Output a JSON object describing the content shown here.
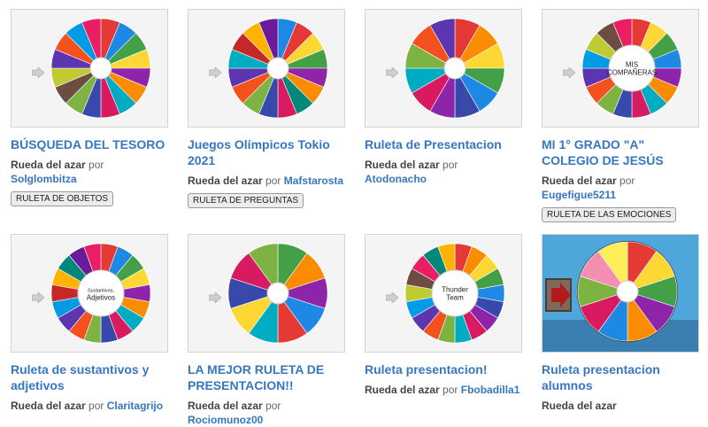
{
  "cards": [
    {
      "title": "BÚSQUEDA DEL TESORO",
      "type": "Rueda del azar",
      "por": "por",
      "author": "Solglombitza",
      "tag": "RULETA DE OBJETOS",
      "colors": [
        "#e53935",
        "#1e88e5",
        "#43a047",
        "#fdd835",
        "#8e24aa",
        "#fb8c00",
        "#00acc1",
        "#d81b60",
        "#3949ab",
        "#7cb342",
        "#6d4c41",
        "#c0ca33",
        "#5e35b1",
        "#f4511e",
        "#039be5",
        "#e91e63"
      ]
    },
    {
      "title": "Juegos Olímpicos Tokio 2021",
      "type": "Rueda del azar",
      "por": "por",
      "author": "Mafstarosta",
      "tag": "RULETA DE PREGUNTAS",
      "colors": [
        "#1e88e5",
        "#e53935",
        "#fdd835",
        "#43a047",
        "#8e24aa",
        "#fb8c00",
        "#00897b",
        "#d81b60",
        "#3949ab",
        "#7cb342",
        "#f4511e",
        "#5e35b1",
        "#00acc1",
        "#c62828",
        "#ffb300",
        "#6a1b9a"
      ]
    },
    {
      "title": "Ruleta de Presentacion",
      "type": "Rueda del azar",
      "por": "por",
      "author": "Atodonacho",
      "tag": "",
      "colors": [
        "#e53935",
        "#fb8c00",
        "#fdd835",
        "#43a047",
        "#1e88e5",
        "#3949ab",
        "#8e24aa",
        "#d81b60",
        "#00acc1",
        "#7cb342",
        "#f4511e",
        "#5e35b1"
      ]
    },
    {
      "title": "MI 1° GRADO \"A\" COLEGIO DE JESÚS",
      "type": "Rueda del azar",
      "por": "por",
      "author": "Eugefigue5211",
      "tag": "RULETA DE LAS EMOCIONES",
      "colors": [
        "#e53935",
        "#fdd835",
        "#43a047",
        "#1e88e5",
        "#8e24aa",
        "#fb8c00",
        "#00acc1",
        "#d81b60",
        "#3949ab",
        "#7cb342",
        "#f4511e",
        "#5e35b1",
        "#039be5",
        "#c0ca33",
        "#6d4c41",
        "#e91e63"
      ]
    },
    {
      "title": "Ruleta de sustantivos y adjetivos",
      "type": "Rueda del azar",
      "por": "por",
      "author": "Claritagrijo",
      "tag": "",
      "colors": [
        "#e53935",
        "#1e88e5",
        "#43a047",
        "#fdd835",
        "#8e24aa",
        "#fb8c00",
        "#00acc1",
        "#d81b60",
        "#3949ab",
        "#7cb342",
        "#f4511e",
        "#5e35b1",
        "#039be5",
        "#c62828",
        "#ffb300",
        "#00897b",
        "#6a1b9a",
        "#e91e63"
      ]
    },
    {
      "title": "LA MEJOR RULETA DE PRESENTACION!!",
      "type": "Rueda del azar",
      "por": "por",
      "author": "Rociomunoz00",
      "tag": "",
      "colors": [
        "#43a047",
        "#fb8c00",
        "#8e24aa",
        "#1e88e5",
        "#e53935",
        "#00acc1",
        "#fdd835",
        "#3949ab",
        "#d81b60",
        "#7cb342"
      ]
    },
    {
      "title": "Ruleta presentacion!",
      "type": "Rueda del azar",
      "por": "por",
      "author": "Fbobadilla1",
      "tag": "",
      "colors": [
        "#e53935",
        "#fb8c00",
        "#fdd835",
        "#43a047",
        "#1e88e5",
        "#3949ab",
        "#8e24aa",
        "#d81b60",
        "#00acc1",
        "#7cb342",
        "#f4511e",
        "#5e35b1",
        "#039be5",
        "#c0ca33",
        "#6d4c41",
        "#e91e63",
        "#00897b",
        "#ffb300"
      ]
    },
    {
      "title": "Ruleta presentacion alumnos",
      "type": "Rueda del azar",
      "por": "",
      "author": "",
      "tag": "",
      "colors": [
        "#e53935",
        "#fdd835",
        "#43a047",
        "#8e24aa",
        "#fb8c00",
        "#1e88e5",
        "#d81b60",
        "#7cb342",
        "#f48fb1",
        "#ffee58"
      ]
    }
  ],
  "centers": [
    "",
    "",
    "",
    "MIS COMPAÑERAS",
    "Sustantivos, Adjetivos",
    "",
    "Thunder Team",
    ""
  ]
}
